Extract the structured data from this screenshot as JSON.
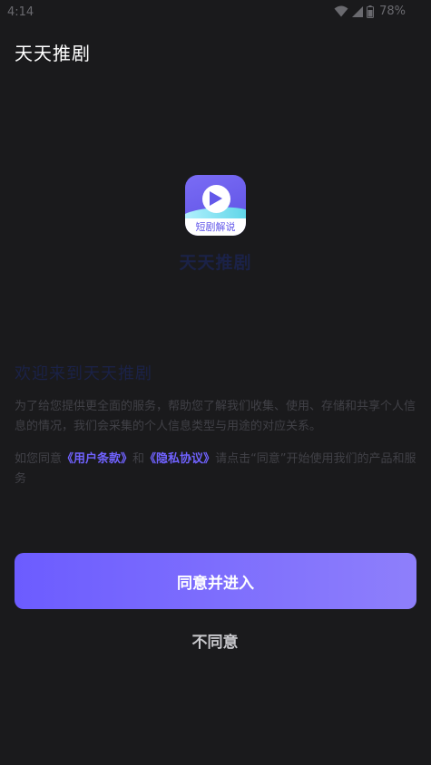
{
  "status_bar": {
    "time": "4:14",
    "battery": "78%",
    "icons": [
      "wifi-icon",
      "cellular-signal-icon",
      "battery-icon"
    ]
  },
  "header": {
    "title": "天天推剧"
  },
  "logo": {
    "label": "短剧解说",
    "icon": "play-icon",
    "colors": {
      "background": "#6358ea",
      "wave": "#58d3e6"
    }
  },
  "app_name": "天天推剧",
  "welcome": {
    "title": "欢迎来到天天推剧",
    "intro": "为了给您提供更全面的服务，帮助您了解我们收集、使用、存储和共享个人信息的情况，我们会采集的个人信息类型与用途的对应关系。",
    "consent_prefix": "如您同意",
    "user_terms": "《用户条款》",
    "conjunction": "和",
    "privacy_policy": "《隐私协议》",
    "consent_suffix": "请点击“同意”开始使用我们的产品和服务"
  },
  "actions": {
    "agree": "同意并进入",
    "disagree": "不同意"
  },
  "colors": {
    "accent": "#7062ff",
    "page_background": "#1a1a1c"
  }
}
